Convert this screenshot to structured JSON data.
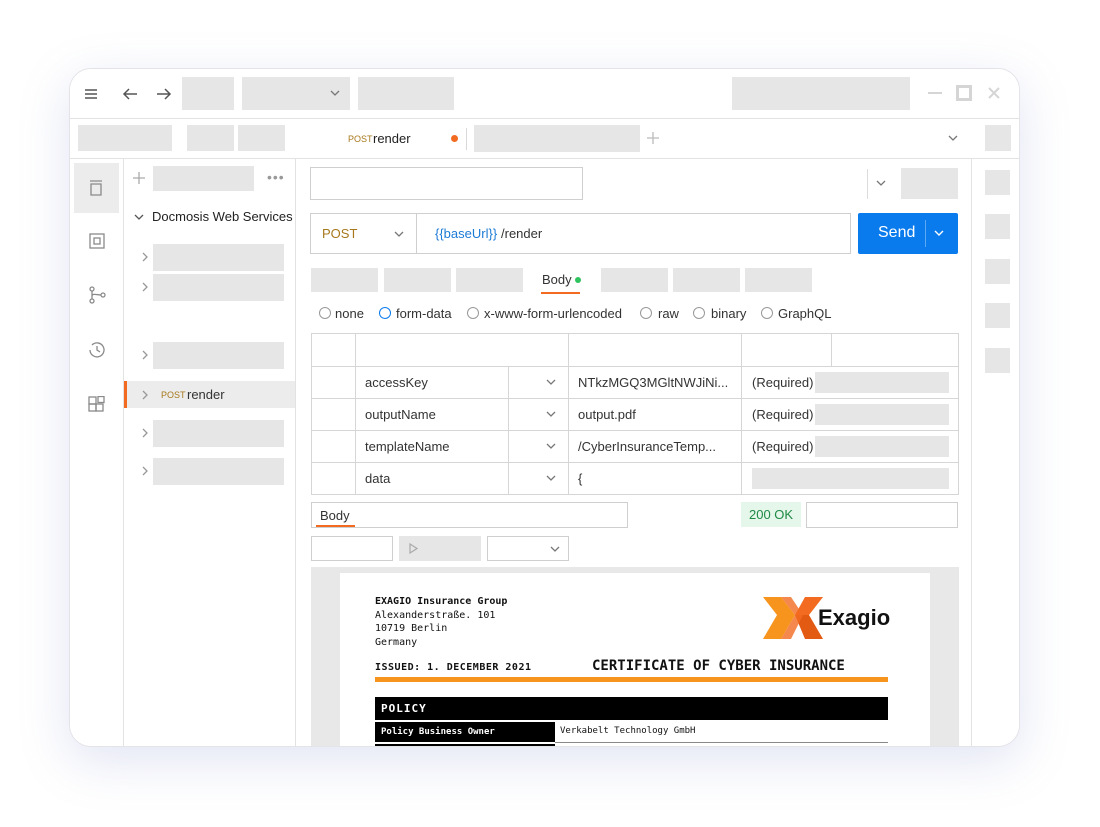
{
  "tab": {
    "method": "POST",
    "name": "render"
  },
  "collection": {
    "name": "Docmosis Web Services",
    "active_item": {
      "method": "POST",
      "name": "render"
    }
  },
  "request": {
    "method": "POST",
    "url_var": "{{baseUrl}}",
    "url_path": "/render",
    "send_label": "Send",
    "active_tab": "Body"
  },
  "body_types": [
    "none",
    "form-data",
    "x-www-form-urlencoded",
    "raw",
    "binary",
    "GraphQL"
  ],
  "params": [
    {
      "key": "accessKey",
      "value": "NTkzMGQ3MGltNWJiNi...",
      "desc": "(Required)"
    },
    {
      "key": "outputName",
      "value": "output.pdf",
      "desc": "(Required)"
    },
    {
      "key": "templateName",
      "value": "/CyberInsuranceTemp...",
      "desc": "(Required)"
    },
    {
      "key": "data",
      "value": "{",
      "desc": ""
    }
  ],
  "response": {
    "tab": "Body",
    "status": "200 OK"
  },
  "document": {
    "company": "EXAGIO Insurance Group",
    "street": "Alexanderstraße. 101",
    "city": "10719 Berlin",
    "country": "Germany",
    "logo_text": "Exagio",
    "issued": "ISSUED: 1. DECEMBER 2021",
    "title": "CERTIFICATE OF CYBER INSURANCE",
    "section": "POLICY",
    "row_label": "Policy Business Owner",
    "row_value": "Verkabelt Technology GmbH"
  },
  "colors": {
    "accent_orange": "#f26b21",
    "send_blue": "#097bed",
    "method_gold": "#a7781b",
    "url_var_blue": "#1d7bd6",
    "status_green_bg": "#e5f6ea",
    "status_green_text": "#1f8a46"
  }
}
